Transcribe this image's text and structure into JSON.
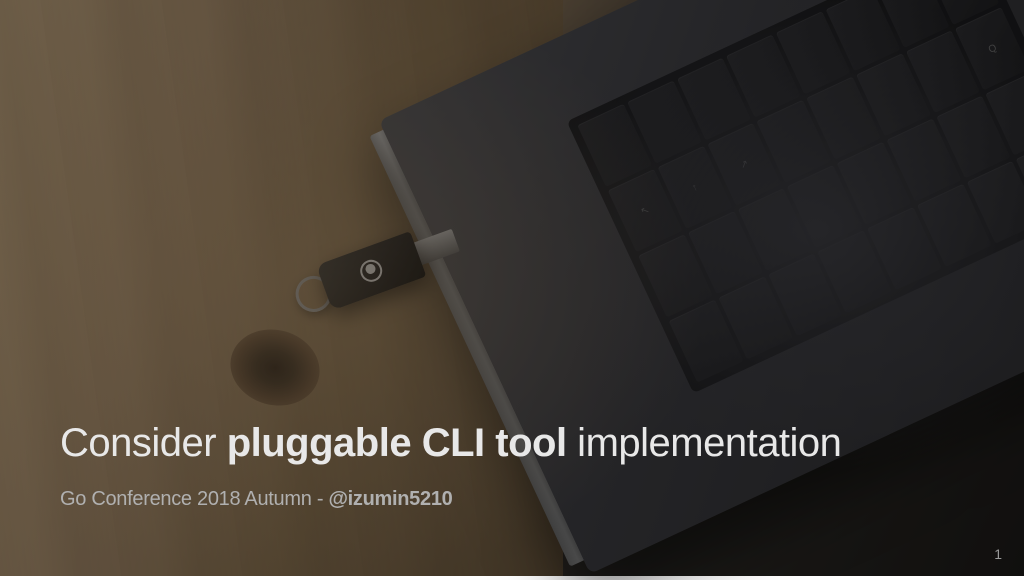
{
  "title": {
    "prefix": "Consider ",
    "bold": "pluggable CLI tool",
    "suffix": " implementation"
  },
  "subtitle": {
    "prefix": "Go Conference 2018 Autumn - ",
    "bold": "@izumin5210"
  },
  "page_number": "1"
}
